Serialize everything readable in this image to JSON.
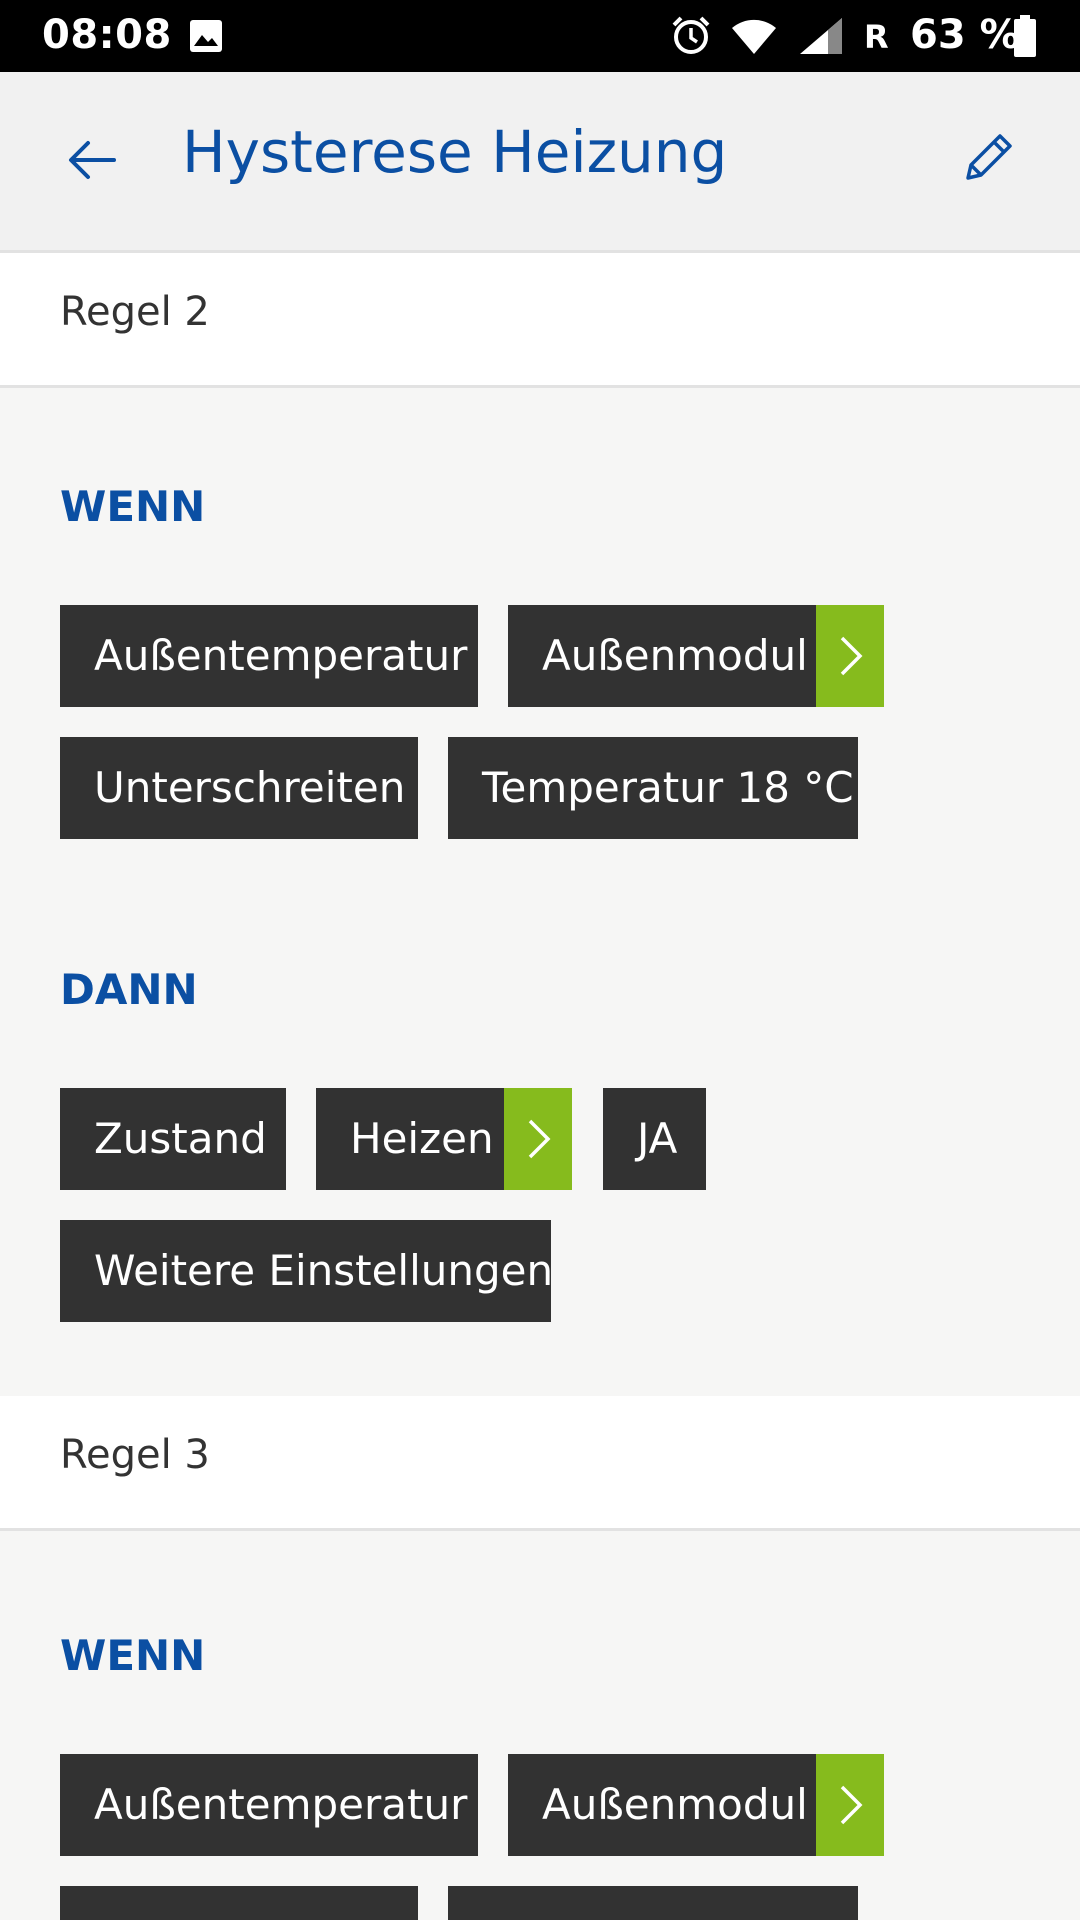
{
  "status_bar": {
    "time": "08:08",
    "roaming": "R",
    "battery": "63 %",
    "icons": [
      "gallery-icon",
      "alarm-icon",
      "wifi-icon",
      "signal-icon",
      "battery-icon"
    ]
  },
  "app_bar": {
    "title": "Hysterese Heizung",
    "back_icon": "arrow-left-icon",
    "edit_icon": "pencil-icon"
  },
  "colors": {
    "accent_blue": "#0b4fa3",
    "chip_dark": "#323232",
    "arrow_green": "#86bb1d",
    "background": "#f6f6f5"
  },
  "rules": [
    {
      "title": "Regel 2",
      "wenn": {
        "label": "WENN",
        "chips": [
          "Außentemperatur",
          "Außenmodul",
          "Unterschreiten",
          "Temperatur 18 °C"
        ]
      },
      "dann": {
        "label": "DANN",
        "chips": [
          "Zustand",
          "Heizen",
          "JA",
          "Weitere Einstellungen"
        ]
      }
    },
    {
      "title": "Regel 3",
      "wenn": {
        "label": "WENN",
        "chips": [
          "Außentemperatur",
          "Außenmodul"
        ]
      }
    }
  ]
}
